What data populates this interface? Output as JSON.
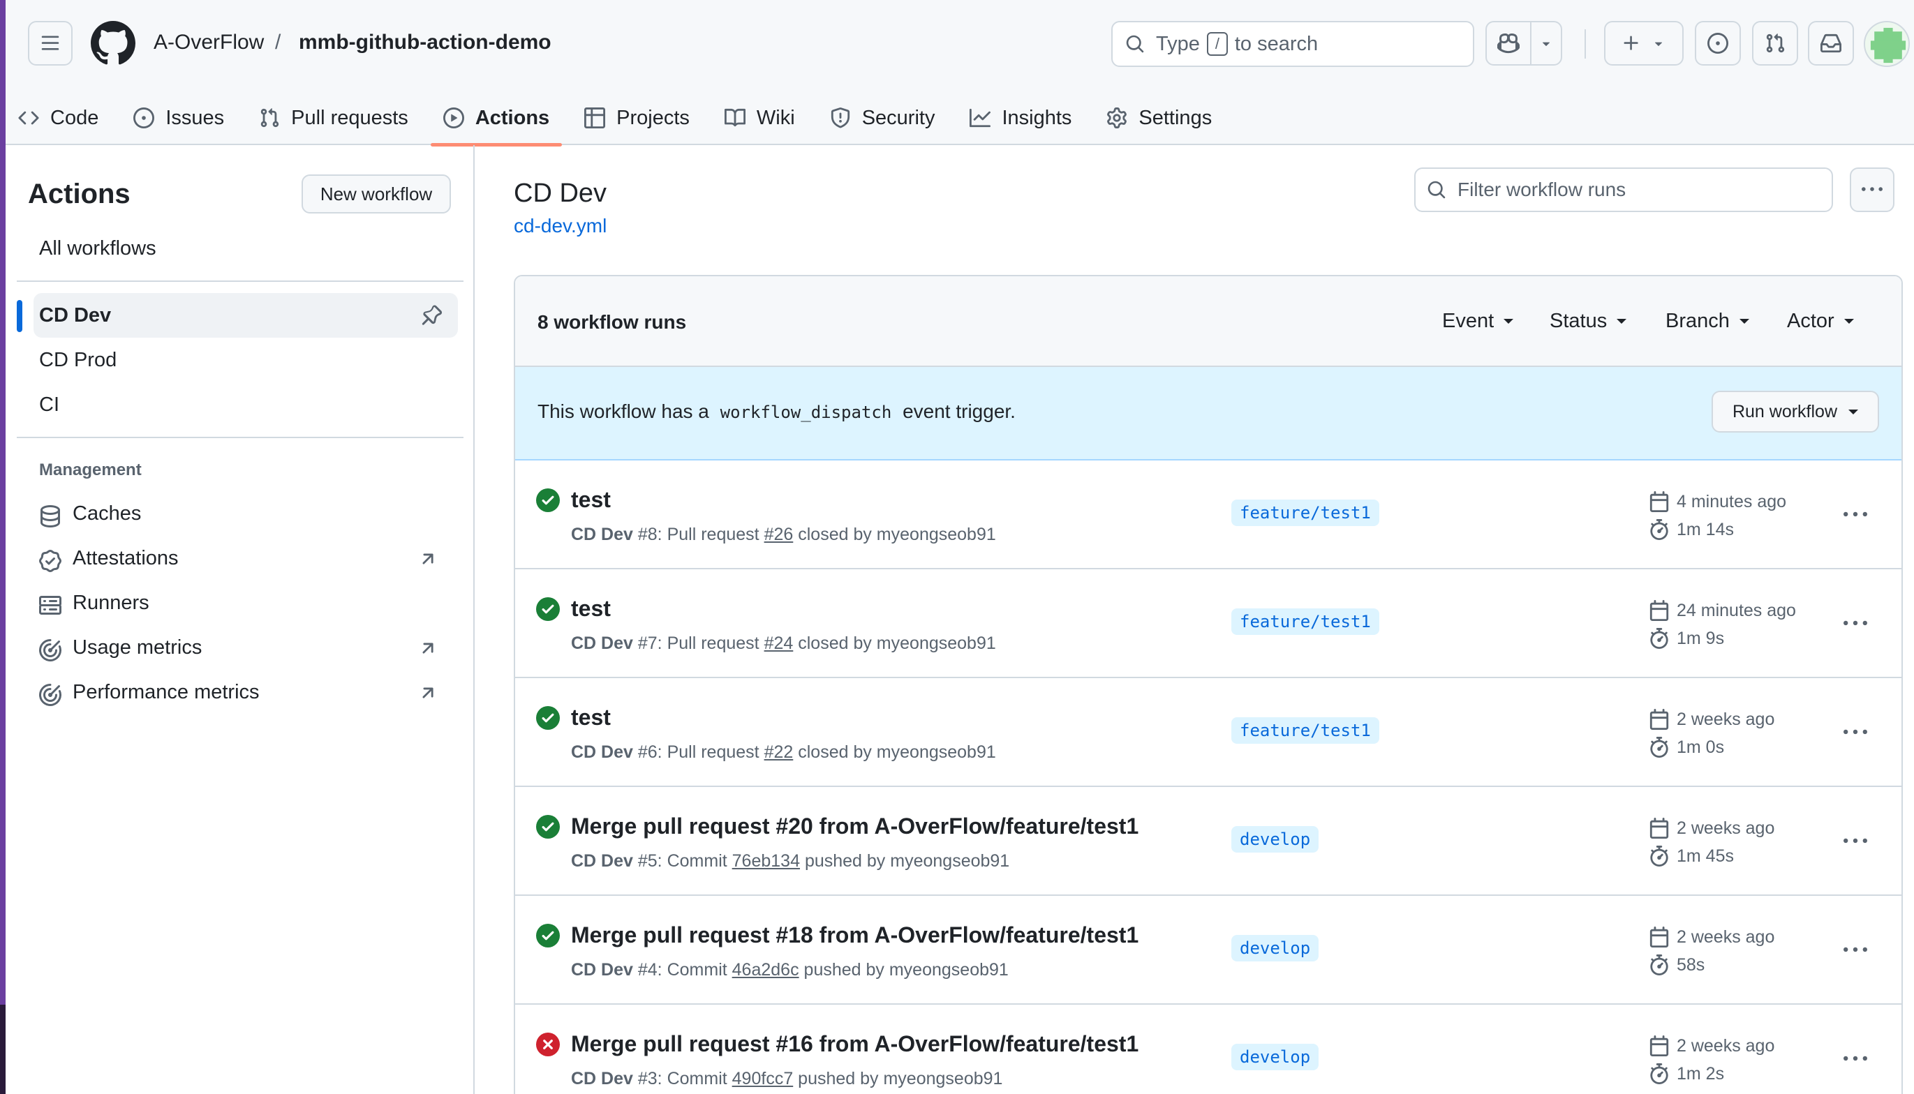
{
  "header": {
    "owner": "A-OverFlow",
    "separator": "/",
    "repo": "mmb-github-action-demo",
    "search_prefix": "Type",
    "search_key": "/",
    "search_suffix": "to search"
  },
  "tabs": [
    {
      "label": "Code",
      "icon": "code-icon"
    },
    {
      "label": "Issues",
      "icon": "issue-opened-icon"
    },
    {
      "label": "Pull requests",
      "icon": "git-pull-request-icon"
    },
    {
      "label": "Actions",
      "icon": "play-icon",
      "active": true
    },
    {
      "label": "Projects",
      "icon": "table-icon"
    },
    {
      "label": "Wiki",
      "icon": "book-icon"
    },
    {
      "label": "Security",
      "icon": "shield-icon"
    },
    {
      "label": "Insights",
      "icon": "graph-icon"
    },
    {
      "label": "Settings",
      "icon": "gear-icon"
    }
  ],
  "sidebar": {
    "title": "Actions",
    "new_workflow": "New workflow",
    "all_workflows": "All workflows",
    "workflows": [
      {
        "label": "CD Dev",
        "active": true
      },
      {
        "label": "CD Prod"
      },
      {
        "label": "CI"
      }
    ],
    "management_heading": "Management",
    "management": [
      {
        "label": "Caches",
        "icon": "database-icon",
        "external": false
      },
      {
        "label": "Attestations",
        "icon": "verified-icon",
        "external": true
      },
      {
        "label": "Runners",
        "icon": "server-icon",
        "external": false
      },
      {
        "label": "Usage metrics",
        "icon": "meter-icon",
        "external": true
      },
      {
        "label": "Performance metrics",
        "icon": "meter-icon",
        "external": true
      }
    ]
  },
  "main": {
    "title": "CD Dev",
    "file": "cd-dev.yml",
    "filter_placeholder": "Filter workflow runs",
    "runs_count": "8 workflow runs",
    "filters": [
      "Event",
      "Status",
      "Branch",
      "Actor"
    ],
    "dispatch_before": "This workflow has a",
    "dispatch_code": "workflow_dispatch",
    "dispatch_after": "event trigger.",
    "run_workflow": "Run workflow"
  },
  "runs": [
    {
      "title": "test",
      "status": "success",
      "workflow": "CD Dev",
      "num": "#8:",
      "kind": "Pull request",
      "ref": "#26",
      "action": "closed by myeongseob91",
      "branch": "feature/test1",
      "when": "4 minutes ago",
      "duration": "1m 14s"
    },
    {
      "title": "test",
      "status": "success",
      "workflow": "CD Dev",
      "num": "#7:",
      "kind": "Pull request",
      "ref": "#24",
      "action": "closed by myeongseob91",
      "branch": "feature/test1",
      "when": "24 minutes ago",
      "duration": "1m 9s"
    },
    {
      "title": "test",
      "status": "success",
      "workflow": "CD Dev",
      "num": "#6:",
      "kind": "Pull request",
      "ref": "#22",
      "action": "closed by myeongseob91",
      "branch": "feature/test1",
      "when": "2 weeks ago",
      "duration": "1m 0s"
    },
    {
      "title": "Merge pull request #20 from A-OverFlow/feature/test1",
      "status": "success",
      "workflow": "CD Dev",
      "num": "#5:",
      "kind": "Commit",
      "ref": "76eb134",
      "action": "pushed by myeongseob91",
      "branch": "develop",
      "when": "2 weeks ago",
      "duration": "1m 45s"
    },
    {
      "title": "Merge pull request #18 from A-OverFlow/feature/test1",
      "status": "success",
      "workflow": "CD Dev",
      "num": "#4:",
      "kind": "Commit",
      "ref": "46a2d6c",
      "action": "pushed by myeongseob91",
      "branch": "develop",
      "when": "2 weeks ago",
      "duration": "58s"
    },
    {
      "title": "Merge pull request #16 from A-OverFlow/feature/test1",
      "status": "failure",
      "workflow": "CD Dev",
      "num": "#3:",
      "kind": "Commit",
      "ref": "490fcc7",
      "action": "pushed by myeongseob91",
      "branch": "develop",
      "when": "2 weeks ago",
      "duration": "1m 2s"
    }
  ],
  "colors": {
    "success": "#1a7f37",
    "failure": "#cf222e",
    "link": "#0969da",
    "active_tab_underline": "#fd8c73"
  }
}
